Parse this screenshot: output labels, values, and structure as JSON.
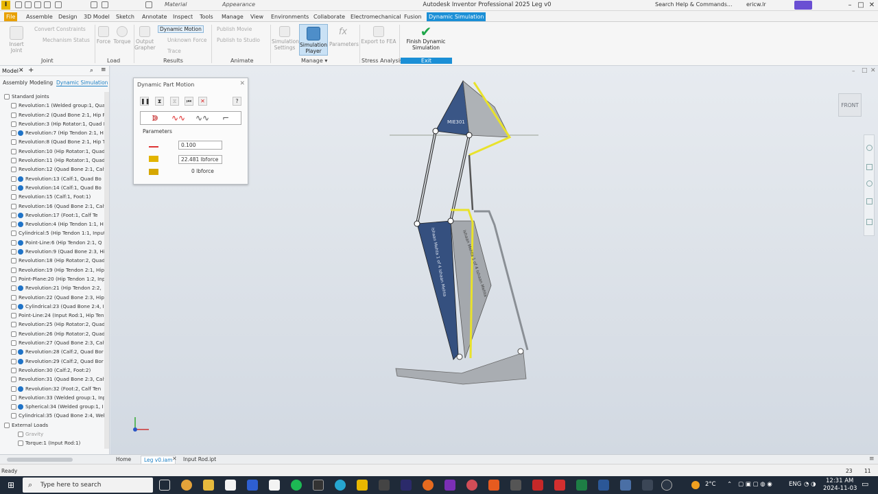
{
  "window": {
    "title": "Autodesk Inventor Professional 2025   Leg v0",
    "appearance": "Appearance",
    "material": "Material",
    "search": "Search Help & Commands...",
    "user": "ericw.lr"
  },
  "ribbon_tabs": [
    "File",
    "Assemble",
    "Design",
    "3D Model",
    "Sketch",
    "Annotate",
    "Inspect",
    "Tools",
    "Manage",
    "View",
    "Environments",
    "Collaborate",
    "Electromechanical",
    "Fusion",
    "Dynamic Simulation"
  ],
  "ribbon": {
    "insert_joint": "Insert Joint",
    "convert_constraints": "Convert Constraints",
    "mechanism_status": "Mechanism Status",
    "force": "Force",
    "torque": "Torque",
    "output_grapher": "Output Grapher",
    "dynamic_motion": "Dynamic Motion",
    "unknown_force": "Unknown Force",
    "trace": "Trace",
    "publish_movie": "Publish Movie",
    "publish_to_studio": "Publish to Studio",
    "simulation_settings": "Simulation Settings",
    "simulation_player": "Simulation Player",
    "parameters": "Parameters",
    "export_to_fea": "Export to FEA",
    "finish": "Finish Dynamic Simulation",
    "groups": {
      "joint": "Joint",
      "load": "Load",
      "results": "Results",
      "animate": "Animate",
      "manage": "Manage ▾",
      "stress": "Stress Analysis",
      "exit": "Exit"
    }
  },
  "browser": {
    "title": "Model",
    "tabs": [
      "Assembly",
      "Modeling",
      "Dynamic Simulation"
    ],
    "items": [
      {
        "label": "Standard Joints",
        "info": false
      },
      {
        "label": "Revolution:1 (Welded group:1, Qua",
        "info": false
      },
      {
        "label": "Revolution:2 (Quad Bone 2:1, Hip R",
        "info": false
      },
      {
        "label": "Revolution:3 (Hip Rotator:1, Quad E",
        "info": false
      },
      {
        "label": "Revolution:7 (Hip Tendon 2:1, H",
        "info": true
      },
      {
        "label": "Revolution:8 (Quad Bone 2:1, Hip Te",
        "info": false
      },
      {
        "label": "Revolution:10 (Hip Rotator:1, Quad",
        "info": false
      },
      {
        "label": "Revolution:11 (Hip Rotator:1, Quad",
        "info": false
      },
      {
        "label": "Revolution:12 (Quad Bone 2:1, Calf",
        "info": false
      },
      {
        "label": "Revolution:13 (Calf:1, Quad Bo",
        "info": true
      },
      {
        "label": "Revolution:14 (Calf:1, Quad Bo",
        "info": true
      },
      {
        "label": "Revolution:15 (Calf:1, Foot:1)",
        "info": false
      },
      {
        "label": "Revolution:16 (Quad Bone 2:1, Calf",
        "info": false
      },
      {
        "label": "Revolution:17 (Foot:1, Calf Te",
        "info": true
      },
      {
        "label": "Revolution:4 (Hip Tendon 1:1, H",
        "info": true
      },
      {
        "label": "Cylindrical:5 (Hip Tendon 1:1, Input",
        "info": false
      },
      {
        "label": "Point-Line:6 (Hip Tendon 2:1, Q",
        "info": true
      },
      {
        "label": "Revolution:9 (Quad Bone 2:3, Hi",
        "info": true
      },
      {
        "label": "Revolution:18 (Hip Rotator:2, Quad",
        "info": false
      },
      {
        "label": "Revolution:19 (Hip Tendon 2:1, Hip",
        "info": false
      },
      {
        "label": "Point-Plane:20 (Hip Tendon 1:2, Inp",
        "info": false
      },
      {
        "label": "Revolution:21 (Hip Tendon 2:2,",
        "info": true
      },
      {
        "label": "Revolution:22 (Quad Bone 2:3, Hip",
        "info": false
      },
      {
        "label": "Cylindrical:23 (Quad Bone 2:4, I",
        "info": true
      },
      {
        "label": "Point-Line:24 (Input Rod:1, Hip Ten",
        "info": false
      },
      {
        "label": "Revolution:25 (Hip Rotator:2, Quad",
        "info": false
      },
      {
        "label": "Revolution:26 (Hip Rotator:2, Quad",
        "info": false
      },
      {
        "label": "Revolution:27 (Quad Bone 2:3, Calf",
        "info": false
      },
      {
        "label": "Revolution:28 (Calf:2, Quad Bor",
        "info": true
      },
      {
        "label": "Revolution:29 (Calf:2, Quad Bor",
        "info": true
      },
      {
        "label": "Revolution:30 (Calf:2, Foot:2)",
        "info": false
      },
      {
        "label": "Revolution:31 (Quad Bone 2:3, Calf",
        "info": false
      },
      {
        "label": "Revolution:32 (Foot:2, Calf Ten",
        "info": true
      },
      {
        "label": "Revolution:33 (Welded group:1, Inp",
        "info": false
      },
      {
        "label": "Spherical:34 (Welded group:1, I",
        "info": true
      },
      {
        "label": "Cylindrical:35 (Quad Bone 2:4, Weld",
        "info": false
      },
      {
        "label": "External Loads",
        "info": false
      },
      {
        "label": "Gravity",
        "info": false
      },
      {
        "label": "Torque:1 (Input Rod:1)",
        "info": false
      }
    ]
  },
  "dialog": {
    "title": "Dynamic Part Motion",
    "params_label": "Parameters",
    "value1": "0.100",
    "value2": "22.481 lbforce",
    "value3": "0 lbforce"
  },
  "viewport": {
    "viewcube": "FRONT",
    "part_label1": "MIE301",
    "part_label2": "Ishaan Mehta 1 of 4 Ishaan Mehta",
    "part_label3": "Ishaan Mehta 1 of 4 Ishaan Mehta"
  },
  "doc_tabs": {
    "home": "Home",
    "leg": "Leg v0.iam",
    "input": "Input Rod.ipt"
  },
  "status": {
    "text": "Ready",
    "left_num": "23",
    "right_num": "11"
  },
  "taskbar": {
    "search": "Type here to search",
    "temp": "2°C",
    "lang": "ENG",
    "time": "12:31 AM",
    "date": "2024-11-03"
  },
  "colors": {
    "accent": "#1b8fd6",
    "file_tab": "#e8a000",
    "highlight": "#e9e22b",
    "part_blue": "#35507f",
    "part_grey": "#a9adb2"
  }
}
